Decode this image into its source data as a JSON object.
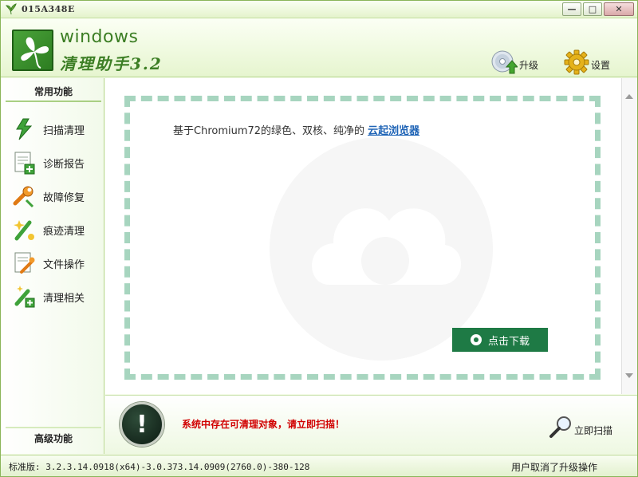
{
  "window": {
    "title": "015A348E",
    "controls": {
      "minimize": "—",
      "maximize": "□",
      "close": "✕"
    }
  },
  "header": {
    "brand_top": "windows",
    "brand_bottom": "清理助手3.2",
    "upgrade_label": "升级",
    "settings_label": "设置"
  },
  "sidebar": {
    "section_top": "常用功能",
    "items": [
      {
        "label": "扫描清理",
        "icon": "lightning-icon"
      },
      {
        "label": "诊断报告",
        "icon": "report-add-icon"
      },
      {
        "label": "故障修复",
        "icon": "wrench-icon"
      },
      {
        "label": "痕迹清理",
        "icon": "broom-icon"
      },
      {
        "label": "文件操作",
        "icon": "document-edit-icon"
      },
      {
        "label": "清理相关",
        "icon": "tools-icon"
      }
    ],
    "section_bottom": "高级功能"
  },
  "ad": {
    "text": "基于Chromium72的绿色、双核、纯净的",
    "link": "云起浏览器",
    "download_button": "点击下载"
  },
  "status": {
    "alert_symbol": "!",
    "message": "系统中存在可清理对象，请立即扫描！",
    "scan_button": "立即扫描"
  },
  "statusbar": {
    "version": "标准版: 3.2.3.14.0918(x64)-3.0.373.14.0909(2760.0)-380-128",
    "notice": "用户取消了升级操作"
  },
  "colors": {
    "brand_green": "#3c7e24",
    "frame_dash": "#a7d5bf",
    "download_green": "#1e7a45",
    "alert_red": "#d10000",
    "link_blue": "#1f64b6"
  }
}
